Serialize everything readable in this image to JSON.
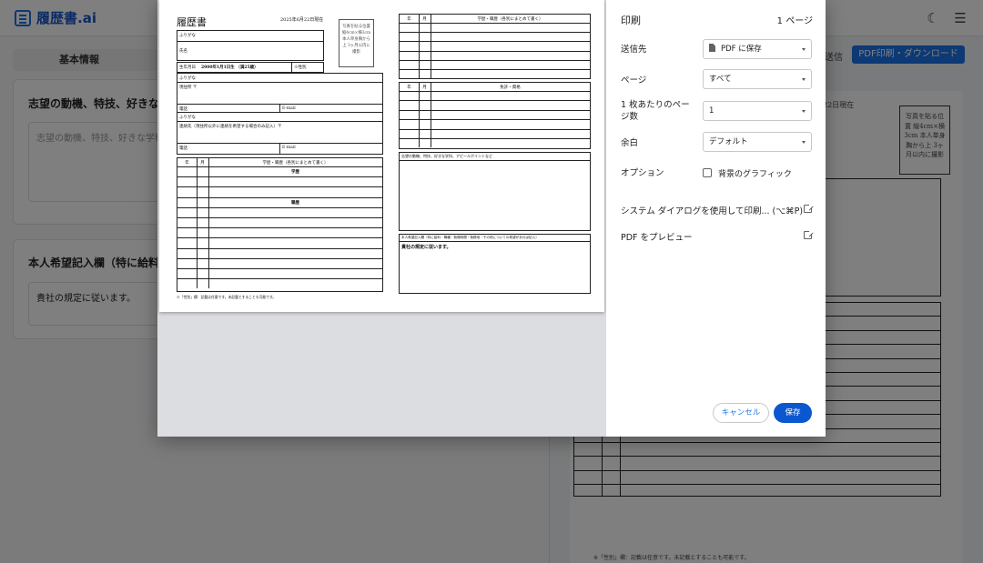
{
  "app": {
    "logo_text": "履歴書.ai",
    "tab_basic": "基本情報",
    "card1_title": "志望の動機、特技、好きな学科、",
    "card1_placeholder": "志望の動機、特技、好きな学科、",
    "card2_title": "本人希望記入欄（特に給料・職",
    "card2_value": "貴社の規定に従います。",
    "send_label": "送信",
    "pdf_button": "PDF印刷・ダウンロード",
    "date_fragment": "22日現在",
    "photo_text": "写真を貼る位置 縦4cm×横3cm 本人単身胸から上 3ヶ月以内に撮影",
    "note": "※「性別」欄：記載は任意です。未記載とすることも可能です。"
  },
  "page": {
    "title": "履歴書",
    "date": "2025年6月22日現在",
    "photo_text": "写真を貼る位置 縦4cm×横3cm 本人単身胸から上 3ヶ月以内に撮影",
    "furigana": "ふりがな",
    "name_label": "氏名",
    "birth_label": "生年月日",
    "birth_value": "2000年1月1日生 （満25歳）",
    "gender_label": "※性別",
    "address_label": "現住所 〒",
    "tel_label": "電話",
    "email_label": "E-mail",
    "contact_label": "連絡先（現住所以外に連絡を希望する場合のみ記入）〒",
    "col_year": "年",
    "col_month": "月",
    "col_history": "学歴・職歴（各別にまとめて書く）",
    "education_heading": "学歴",
    "work_heading": "職歴",
    "note": "※「性別」欄：記載は任意です。未記載とすることも可能です。",
    "col_license": "免許・資格",
    "motivation_label": "志望の動機、特技、好きな学科、アピールポイントなど",
    "request_label": "本人希望記入欄（特に給料・職種・勤務時間・勤務地・その他についての希望があれば記入）",
    "request_value": "貴社の規定に従います。"
  },
  "dialog": {
    "title": "印刷",
    "page_count": "1 ページ",
    "destination_label": "送信先",
    "destination_value": "PDF に保存",
    "pages_label": "ページ",
    "pages_value": "すべて",
    "per_sheet_label": "1 枚あたりのページ数",
    "per_sheet_value": "1",
    "margins_label": "余白",
    "margins_value": "デフォルト",
    "options_label": "オプション",
    "background_graphics_label": "背景のグラフィック",
    "system_dialog_link": "システム ダイアログを使用して印刷... (⌥⌘P)",
    "pdf_preview_link": "PDF をプレビュー",
    "cancel_button": "キャンセル",
    "save_button": "保存"
  },
  "colors": {
    "accent": "#1a73e8",
    "save_button": "#0b57d0"
  }
}
